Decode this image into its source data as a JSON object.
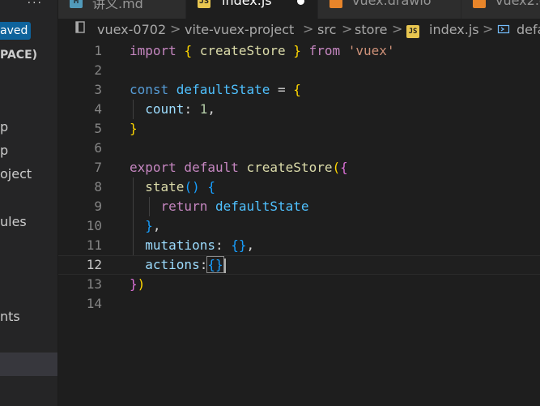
{
  "sidebar": {
    "top_text": "···",
    "saved_badge": "aved",
    "section": "PACE)",
    "items": [
      "p",
      "p",
      "oject",
      "ules",
      "nts"
    ]
  },
  "tabs": [
    {
      "label": "讲义.md",
      "icon": "markdown-icon",
      "active": false
    },
    {
      "label": "index.js",
      "icon": "js-icon",
      "active": true,
      "modified": true
    },
    {
      "label": "vuex.drawio",
      "icon": "drawio-icon",
      "active": false
    },
    {
      "label": "vuex2.d",
      "icon": "drawio-icon",
      "active": false
    }
  ],
  "breadcrumb": {
    "items": [
      "vuex-0702",
      "vite-vuex-project",
      "src",
      "store",
      "index.js",
      "defa"
    ],
    "separator": ">"
  },
  "editor": {
    "current_line": 12,
    "lines": [
      {
        "n": "1",
        "tokens": [
          [
            "kwp",
            "import "
          ],
          [
            "br1",
            "{ "
          ],
          [
            "fn",
            "createStore"
          ],
          [
            "br1",
            " }"
          ],
          [
            "kwp",
            " from "
          ],
          [
            "str",
            "'vuex'"
          ]
        ]
      },
      {
        "n": "2",
        "tokens": []
      },
      {
        "n": "3",
        "tokens": [
          [
            "kw",
            "const "
          ],
          [
            "cst",
            "defaultState"
          ],
          [
            "plain",
            " = "
          ],
          [
            "br1",
            "{"
          ]
        ]
      },
      {
        "n": "4",
        "tokens": [
          [
            "plain",
            "  "
          ],
          [
            "var",
            "count"
          ],
          [
            "plain",
            ": "
          ],
          [
            "num",
            "1"
          ],
          [
            "plain",
            ","
          ]
        ]
      },
      {
        "n": "5",
        "tokens": [
          [
            "br1",
            "}"
          ]
        ]
      },
      {
        "n": "6",
        "tokens": []
      },
      {
        "n": "7",
        "tokens": [
          [
            "kwp",
            "export default "
          ],
          [
            "fn",
            "createStore"
          ],
          [
            "br1",
            "("
          ],
          [
            "br2",
            "{"
          ]
        ]
      },
      {
        "n": "8",
        "tokens": [
          [
            "plain",
            "  "
          ],
          [
            "fn",
            "state"
          ],
          [
            "br3",
            "()"
          ],
          [
            "plain",
            " "
          ],
          [
            "br3",
            "{"
          ]
        ]
      },
      {
        "n": "9",
        "tokens": [
          [
            "plain",
            "    "
          ],
          [
            "kwp",
            "return "
          ],
          [
            "cst",
            "defaultState"
          ]
        ]
      },
      {
        "n": "10",
        "tokens": [
          [
            "plain",
            "  "
          ],
          [
            "br3",
            "}"
          ],
          [
            "plain",
            ","
          ]
        ]
      },
      {
        "n": "11",
        "tokens": [
          [
            "plain",
            "  "
          ],
          [
            "var",
            "mutations"
          ],
          [
            "plain",
            ": "
          ],
          [
            "br3",
            "{}"
          ],
          [
            "plain",
            ","
          ]
        ]
      },
      {
        "n": "12",
        "tokens": [
          [
            "plain",
            "  "
          ],
          [
            "var",
            "actions"
          ],
          [
            "plain",
            ":"
          ],
          [
            "br3m",
            "{}"
          ]
        ]
      },
      {
        "n": "13",
        "tokens": [
          [
            "br2",
            "}"
          ],
          [
            "br1",
            ")"
          ]
        ]
      },
      {
        "n": "14",
        "tokens": []
      }
    ]
  },
  "colors": {
    "background": "#1e1e1e",
    "sidebar": "#252526",
    "accent_badge": "#0e639c",
    "js_icon": "#e8c650",
    "drawio_icon": "#e8852a"
  }
}
